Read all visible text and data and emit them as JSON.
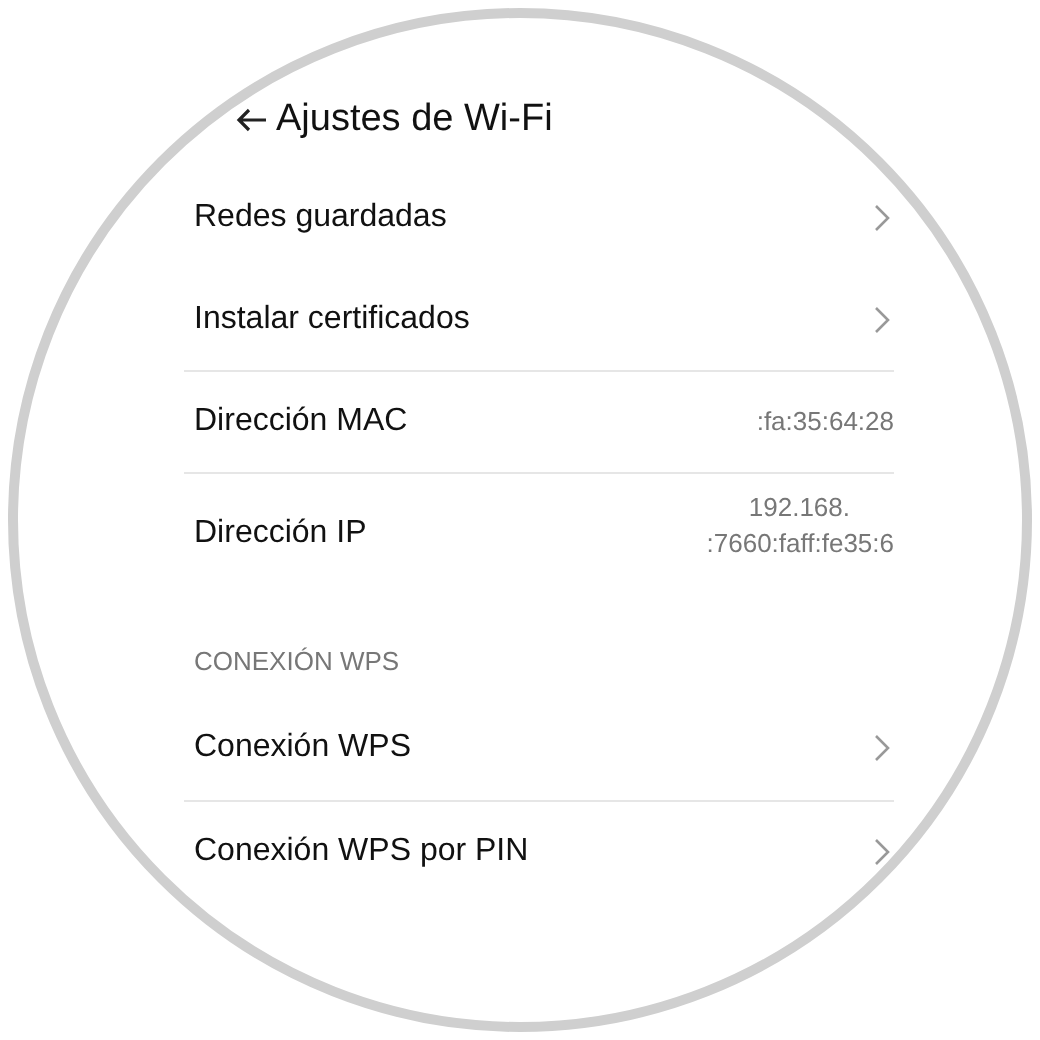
{
  "header": {
    "title": "Ajustes de Wi-Fi"
  },
  "rows": [
    {
      "kind": "link",
      "label": "Redes guardadas",
      "divider": false
    },
    {
      "kind": "link",
      "label": "Instalar certificados",
      "divider": true
    },
    {
      "kind": "value",
      "label": "Dirección MAC",
      "value": [
        ":fa:35:64:28"
      ],
      "divider": true
    },
    {
      "kind": "value",
      "label": "Dirección IP",
      "value": [
        "192.168.",
        ":7660:faff:fe35:6"
      ],
      "divider": false
    },
    {
      "kind": "section",
      "label": "CONEXIÓN WPS"
    },
    {
      "kind": "link",
      "label": "Conexión WPS",
      "divider": true
    },
    {
      "kind": "link",
      "label": "Conexión WPS por PIN",
      "divider": false
    }
  ]
}
